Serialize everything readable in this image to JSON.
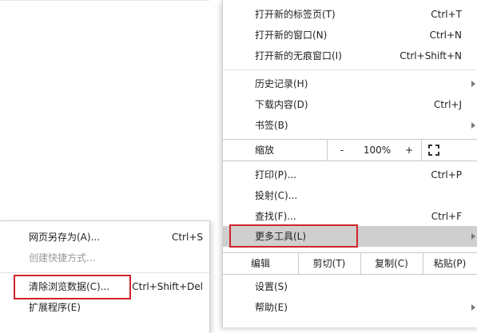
{
  "menu": {
    "items_top": [
      {
        "label": "打开新的标签页(T)",
        "shortcut": "Ctrl+T"
      },
      {
        "label": "打开新的窗口(N)",
        "shortcut": "Ctrl+N"
      },
      {
        "label": "打开新的无痕窗口(I)",
        "shortcut": "Ctrl+Shift+N"
      }
    ],
    "history_label": "历史记录(H)",
    "downloads": {
      "label": "下载内容(D)",
      "shortcut": "Ctrl+J"
    },
    "bookmarks_label": "书签(B)",
    "zoom": {
      "label": "缩放",
      "minus": "-",
      "value": "100%",
      "plus": "+"
    },
    "print": {
      "label": "打印(P)...",
      "shortcut": "Ctrl+P"
    },
    "cast_label": "投射(C)...",
    "find": {
      "label": "查找(F)...",
      "shortcut": "Ctrl+F"
    },
    "more_tools_label": "更多工具(L)",
    "edit": {
      "label": "编辑",
      "cut": "剪切(T)",
      "copy": "复制(C)",
      "paste": "粘贴(P)"
    },
    "settings_label": "设置(S)",
    "help_label": "帮助(E)"
  },
  "submenu": {
    "save_page": {
      "label": "网页另存为(A)...",
      "shortcut": "Ctrl+S"
    },
    "create_shortcut": {
      "label": "创建快捷方式..."
    },
    "clear_data": {
      "label": "清除浏览数据(C)...",
      "shortcut": "Ctrl+Shift+Del"
    },
    "extensions": {
      "label": "扩展程序(E)"
    }
  },
  "highlight_color": "#d0232b"
}
